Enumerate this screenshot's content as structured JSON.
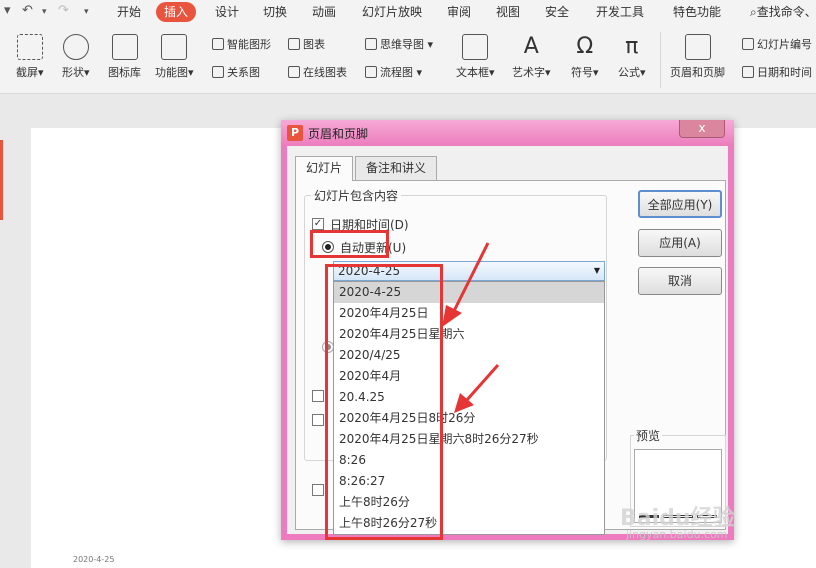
{
  "ribbon_tabs": [
    "开始",
    "插入",
    "设计",
    "切换",
    "动画",
    "幻灯片放映",
    "审阅",
    "视图",
    "安全",
    "开发工具",
    "特色功能"
  ],
  "search_label": "查找命令、",
  "ribbon": {
    "screenshot": "截屏",
    "shape": "形状",
    "icon_library": "图标库",
    "function_chart": "功能图",
    "smart_graphic": "智能图形",
    "chart": "图表",
    "mind_map": "思维导图",
    "relation_chart": "关系图",
    "online_chart": "在线图表",
    "flowchart": "流程图",
    "textbox": "文本框",
    "wordart": "艺术字",
    "symbol": "符号",
    "formula": "公式",
    "header_footer": "页眉和页脚",
    "slide_number": "幻灯片编号",
    "date_time": "日期和时间"
  },
  "dialog": {
    "title": "页眉和页脚",
    "tabs": [
      "幻灯片",
      "备注和讲义"
    ],
    "group_title": "幻灯片包含内容",
    "date_time_label": "日期和时间(D)",
    "auto_update_label": "自动更新(U)",
    "combo_value": "2020-4-25",
    "options": [
      "2020-4-25",
      "2020年4月25日",
      "2020年4月25日星期六",
      "2020/4/25",
      "2020年4月",
      "20.4.25",
      "2020年4月25日8时26分",
      "2020年4月25日星期六8时26分27秒",
      "8:26",
      "8:26:27",
      "上午8时26分",
      "上午8时26分27秒"
    ],
    "buttons": {
      "apply_all": "全部应用(Y)",
      "apply": "应用(A)",
      "cancel": "取消"
    },
    "preview_label": "预览",
    "close_glyph": "x"
  },
  "slide_footer_date": "2020-4-25",
  "watermark": {
    "main": "Baidu经验",
    "sub": "jingyan.baidu.com"
  },
  "colors": {
    "accent": "#e8543e",
    "dialog_border": "#ee7bbf",
    "highlight_box": "#e53535"
  }
}
